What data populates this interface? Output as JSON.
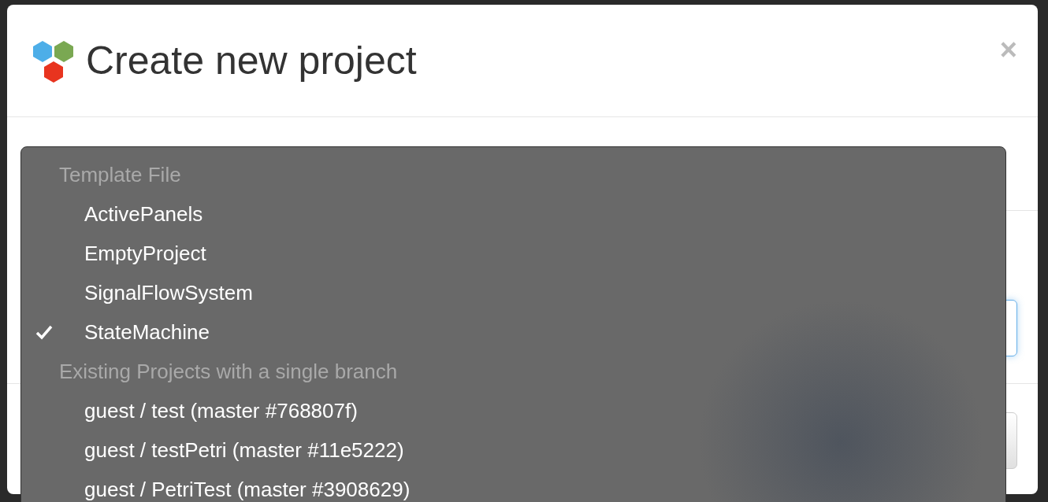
{
  "dialog": {
    "title": "Create new project",
    "close": "×"
  },
  "dropdown": {
    "groups": [
      {
        "header": "Template File",
        "items": [
          {
            "label": "ActivePanels",
            "selected": false
          },
          {
            "label": "EmptyProject",
            "selected": false
          },
          {
            "label": "SignalFlowSystem",
            "selected": false
          },
          {
            "label": "StateMachine",
            "selected": true
          }
        ]
      },
      {
        "header": "Existing Projects with a single branch",
        "items": [
          {
            "label": "guest / test (master #768807f)",
            "selected": false
          },
          {
            "label": "guest / testPetri (master #11e5222)",
            "selected": false
          },
          {
            "label": "guest / PetriTest (master #3908629)",
            "selected": false
          }
        ]
      }
    ]
  }
}
